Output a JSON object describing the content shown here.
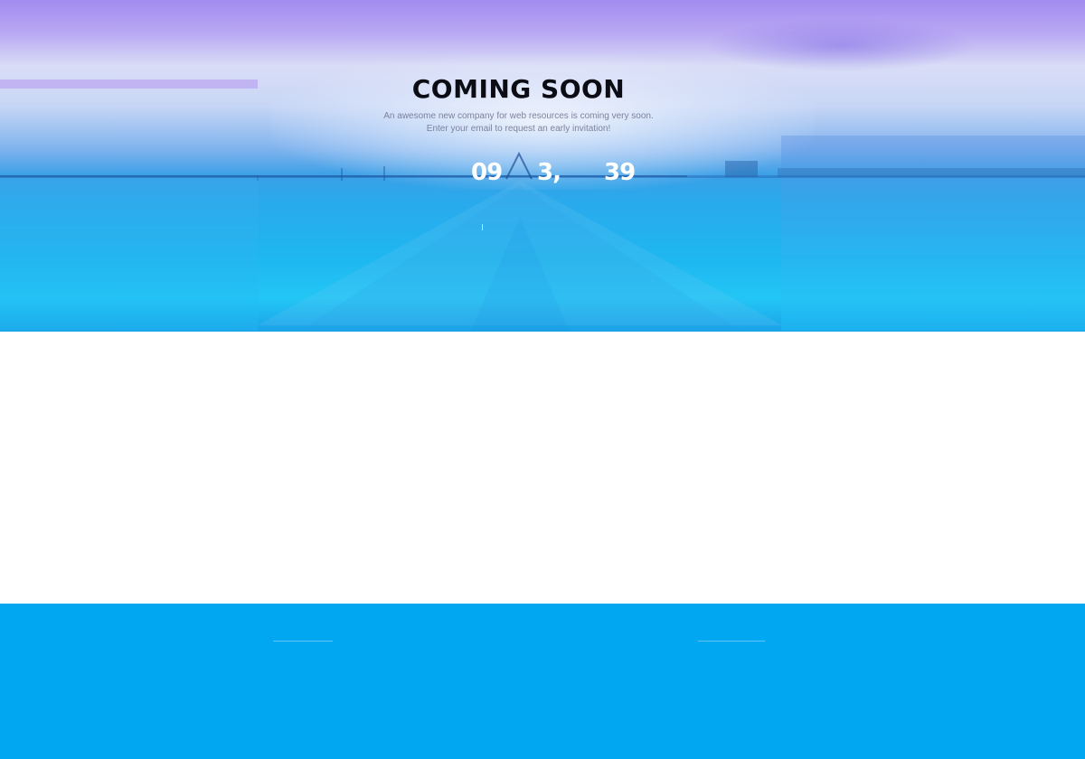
{
  "hero": {
    "title": "COMING SOON",
    "subtitle_line1": "An awesome new company for web resources is coming very soon.",
    "subtitle_line2": "Enter your email to request an early invitation!"
  },
  "countdown": {
    "first": "09",
    "second": "3,",
    "third": "39"
  },
  "colors": {
    "footer_bg": "#02a7f2",
    "title": "#0c0c14",
    "countdown_text": "#ffffff"
  }
}
